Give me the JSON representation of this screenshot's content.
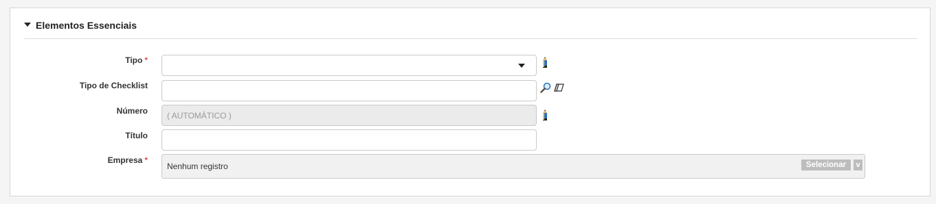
{
  "section": {
    "title": "Elementos Essenciais",
    "expanded": true
  },
  "form": {
    "required_marker": "*",
    "tipo": {
      "label": "Tipo",
      "required": true,
      "value": ""
    },
    "tipo_checklist": {
      "label": "Tipo de Checklist",
      "value": ""
    },
    "numero": {
      "label": "Número",
      "value": "( AUTOMÁTICO )"
    },
    "titulo": {
      "label": "Título",
      "value": ""
    },
    "empresa": {
      "label": "Empresa",
      "required": true,
      "value": "Nenhum registro",
      "select_label": "Selecionar",
      "toggle_label": "v"
    }
  },
  "icons": {
    "tipo": "pencil-icon",
    "tipo_checklist_search": "magnifier-icon",
    "tipo_checklist_clear": "eraser-icon",
    "numero": "pencil-icon"
  },
  "colors": {
    "required": "#d9534f",
    "readonly_bg": "#ebebeb",
    "button_bg": "#bdbdbd"
  }
}
